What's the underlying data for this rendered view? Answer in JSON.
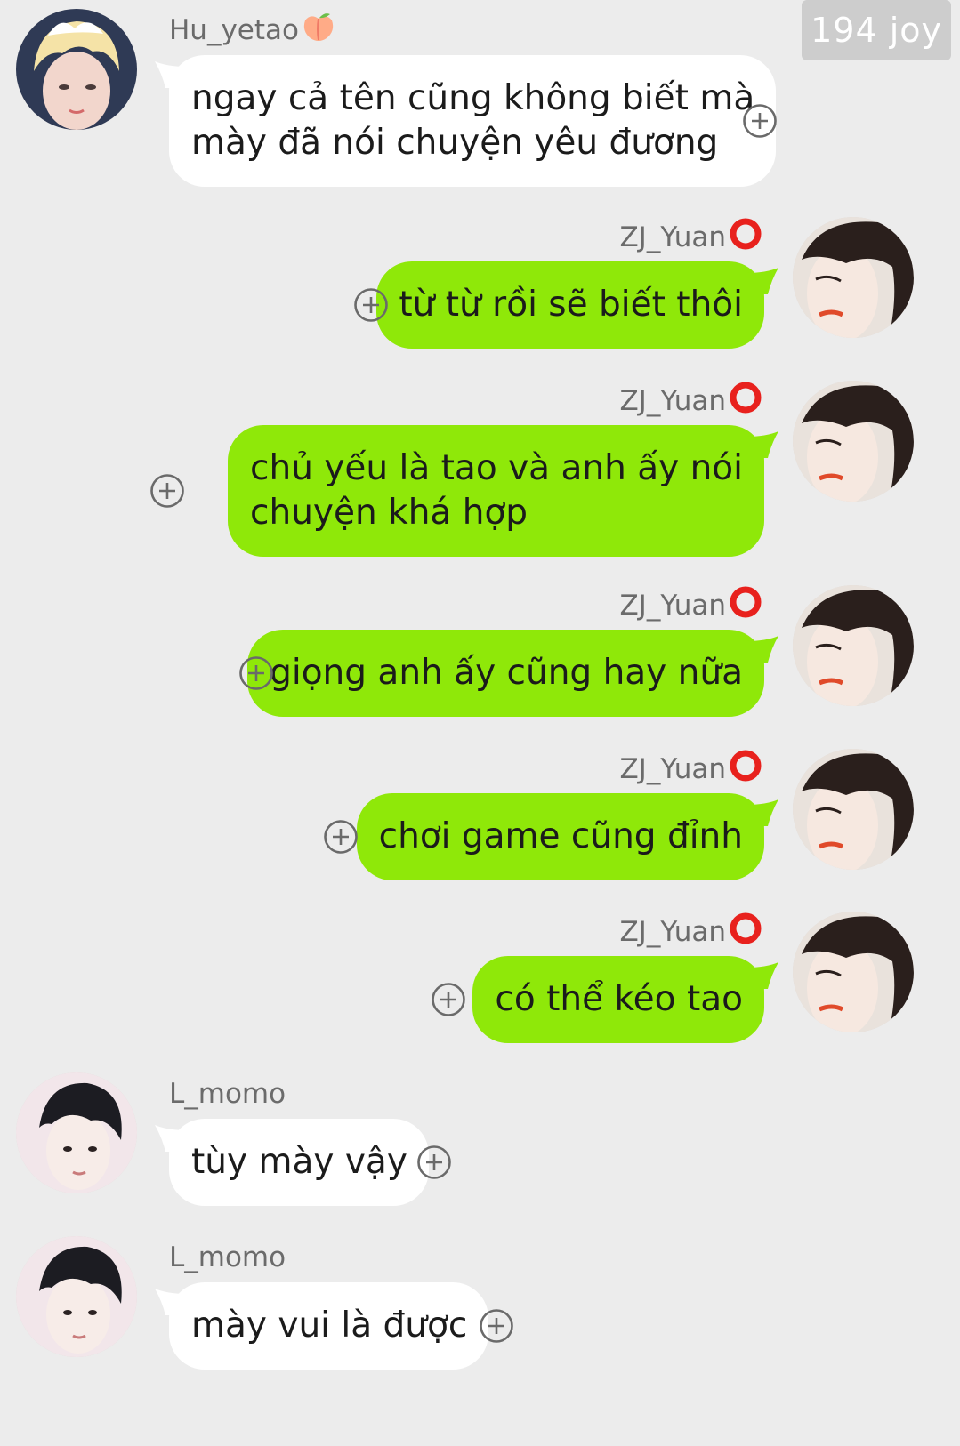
{
  "watermark": "194 joy",
  "emoji": {
    "peach": "🍑",
    "ring": "⭕"
  },
  "messages": [
    {
      "sender": "Hu_yetao",
      "side": "left",
      "name_emoji": "peach",
      "text": "ngay cả tên cũng không biết mà mày đã nói chuyện yêu đương",
      "lines": [
        "ngay cả tên cũng không biết mà",
        "mày đã nói chuyện yêu đương"
      ],
      "avatar": "avatar-blonde-icon"
    },
    {
      "sender": "ZJ_Yuan",
      "side": "right",
      "name_emoji": "ring",
      "text": "từ từ rồi sẽ biết thôi",
      "lines": [
        "từ từ rồi sẽ biết thôi"
      ],
      "avatar": "avatar-dark-hair-icon"
    },
    {
      "sender": "ZJ_Yuan",
      "side": "right",
      "name_emoji": "ring",
      "text": "chủ yếu là tao và anh ấy nói chuyện khá hợp",
      "lines": [
        "chủ yếu là tao và anh ấy nói",
        "chuyện khá hợp"
      ],
      "avatar": "avatar-dark-hair-icon"
    },
    {
      "sender": "ZJ_Yuan",
      "side": "right",
      "name_emoji": "ring",
      "text": "giọng anh ấy cũng hay nữa",
      "lines": [
        "giọng anh ấy cũng hay nữa"
      ],
      "avatar": "avatar-dark-hair-icon"
    },
    {
      "sender": "ZJ_Yuan",
      "side": "right",
      "name_emoji": "ring",
      "text": "chơi game cũng đỉnh",
      "lines": [
        "chơi game cũng đỉnh"
      ],
      "avatar": "avatar-dark-hair-icon"
    },
    {
      "sender": "ZJ_Yuan",
      "side": "right",
      "name_emoji": "ring",
      "text": "có thể kéo tao",
      "lines": [
        "có thể kéo tao"
      ],
      "avatar": "avatar-dark-hair-icon"
    },
    {
      "sender": "L_momo",
      "side": "left",
      "name_emoji": "",
      "text": "tùy mày vậy",
      "lines": [
        "tùy mày vậy"
      ],
      "avatar": "avatar-black-hair-icon"
    },
    {
      "sender": "L_momo",
      "side": "left",
      "name_emoji": "",
      "text": "mày vui là được",
      "lines": [
        "mày vui là được"
      ],
      "avatar": "avatar-black-hair-icon"
    }
  ],
  "colors": {
    "background": "#ececec",
    "my_bubble": "#8fe809",
    "other_bubble": "#ffffff",
    "name_text": "#6b6b6b"
  }
}
